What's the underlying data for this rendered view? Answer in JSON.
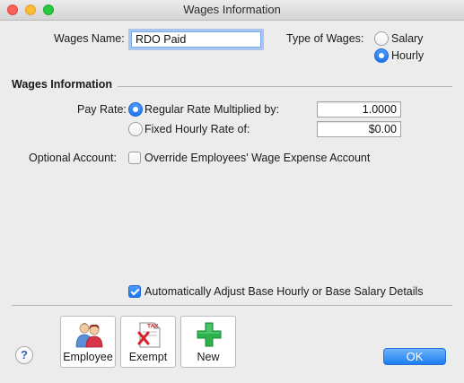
{
  "window": {
    "title": "Wages Information"
  },
  "form": {
    "wages_name_label": "Wages Name:",
    "wages_name_value": "RDO Paid",
    "type_label": "Type of Wages:",
    "type_salary": "Salary",
    "type_hourly": "Hourly",
    "type_selected": "Hourly"
  },
  "section": {
    "title": "Wages Information"
  },
  "pay_rate": {
    "label": "Pay Rate:",
    "option_multiplied": "Regular Rate Multiplied by:",
    "multiplier_value": "1.0000",
    "option_fixed": "Fixed Hourly Rate of:",
    "fixed_value": "$0.00",
    "selected": "Regular Rate Multiplied by:"
  },
  "optional_account": {
    "label": "Optional Account:",
    "override_label": "Override Employees' Wage Expense Account",
    "override_checked": false
  },
  "auto_adjust": {
    "label": "Automatically Adjust Base Hourly or Base Salary Details",
    "checked": true
  },
  "toolbar": {
    "employee_label": "Employee",
    "exempt_label": "Exempt",
    "new_label": "New",
    "exempt_icon_text": "TAX"
  },
  "footer": {
    "help_label": "?",
    "ok_label": "OK"
  },
  "colors": {
    "accent": "#1f75f0",
    "new_icon": "#2bb24c",
    "exempt_icon": "#d4232b"
  },
  "icons": [
    "employee-people-icon",
    "tax-exempt-icon",
    "plus-icon",
    "help-icon"
  ]
}
